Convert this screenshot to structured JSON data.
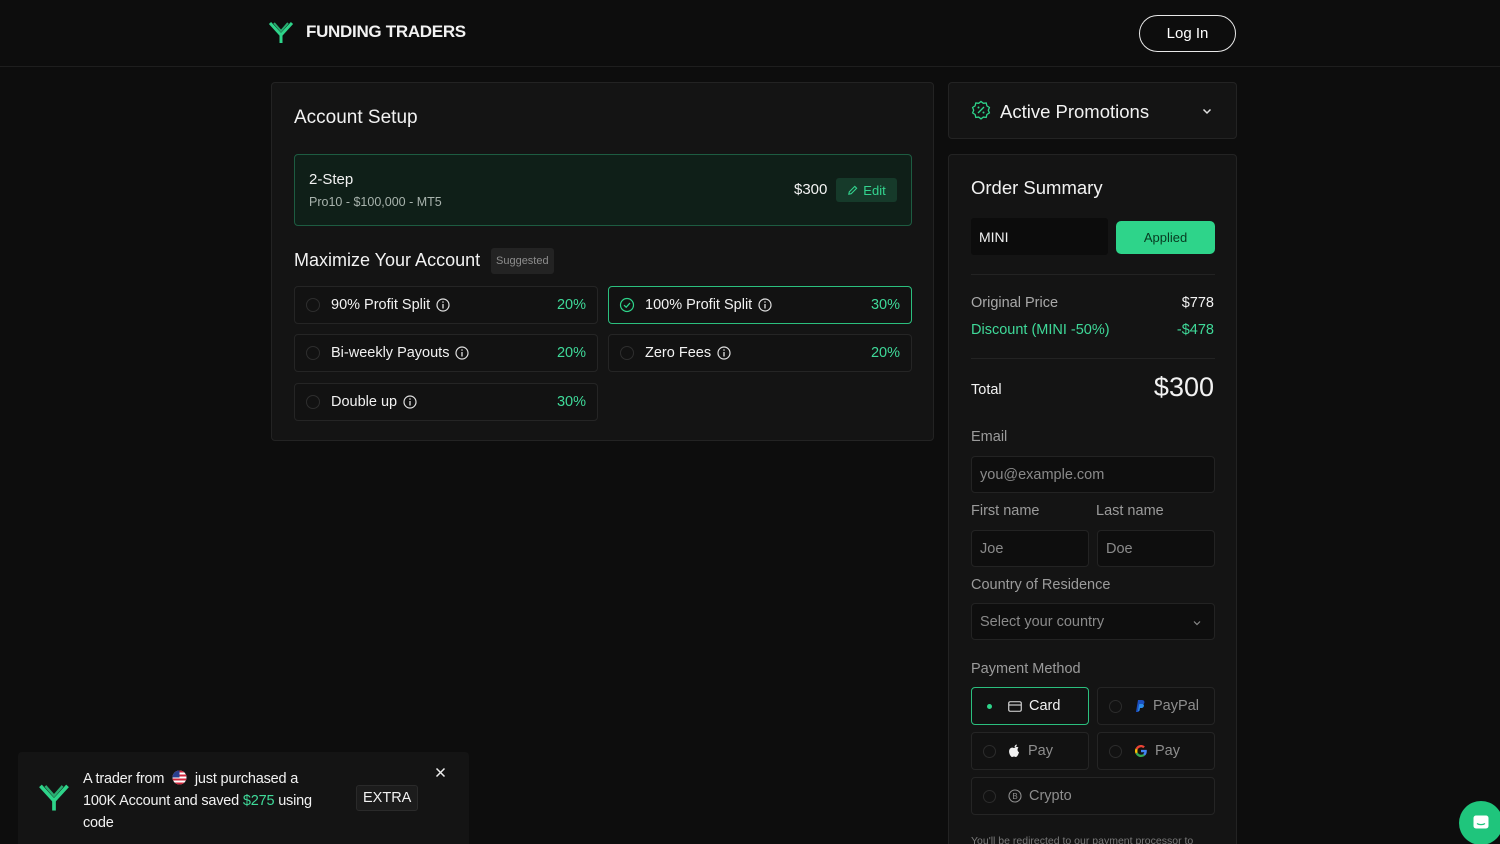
{
  "header": {
    "brand": "FUNDING TRADERS",
    "login_label": "Log In"
  },
  "setup": {
    "title": "Account Setup",
    "plan": {
      "name": "2-Step",
      "description": "Pro10 - $100,000 - MT5",
      "price": "$300",
      "edit_label": "Edit"
    },
    "maximize_title": "Maximize Your Account",
    "suggested_badge": "Suggested",
    "addons": [
      {
        "label": "90% Profit Split",
        "pct": "20%",
        "selected": false
      },
      {
        "label": "100% Profit Split",
        "pct": "30%",
        "selected": true
      },
      {
        "label": "Bi-weekly Payouts",
        "pct": "20%",
        "selected": false
      },
      {
        "label": "Zero Fees",
        "pct": "20%",
        "selected": false
      },
      {
        "label": "Double up",
        "pct": "30%",
        "selected": false
      }
    ]
  },
  "promotions": {
    "title": "Active Promotions"
  },
  "summary": {
    "title": "Order Summary",
    "coupon_value": "MINI",
    "applied_label": "Applied",
    "original_label": "Original Price",
    "original_value": "$778",
    "discount_label": "Discount (MINI -50%)",
    "discount_value": "-$478",
    "total_label": "Total",
    "total_value": "$300",
    "email_label": "Email",
    "email_placeholder": "you@example.com",
    "first_label": "First name",
    "first_placeholder": "Joe",
    "last_label": "Last name",
    "last_placeholder": "Doe",
    "country_label": "Country of Residence",
    "country_placeholder": "Select your country",
    "payment_label": "Payment Method",
    "payment_methods": [
      {
        "label": "Card",
        "icon": "credit-card-icon",
        "selected": true
      },
      {
        "label": "PayPal",
        "icon": "paypal-icon",
        "selected": false
      },
      {
        "label": "Pay",
        "icon": "apple-icon",
        "selected": false
      },
      {
        "label": "Pay",
        "icon": "google-icon",
        "selected": false
      },
      {
        "label": "Crypto",
        "icon": "bitcoin-icon",
        "selected": false
      }
    ],
    "redirect_note": "You'll be redirected to our payment processor to"
  },
  "toast": {
    "text_1": "A trader from",
    "text_2": "just purchased a 100K Account and saved",
    "amount": "$275",
    "text_3": "using code",
    "code": "EXTRA"
  },
  "colors": {
    "accent": "#2ed48a",
    "background": "#0d0d0d",
    "panel": "#141414"
  }
}
